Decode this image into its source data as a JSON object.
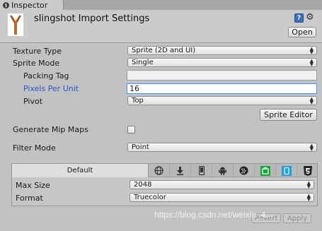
{
  "tab": {
    "title": "Inspector"
  },
  "header": {
    "asset_name": "slingshot Import Settings",
    "open_label": "Open"
  },
  "fields": {
    "texture_type": {
      "label": "Texture Type",
      "value": "Sprite (2D and UI)"
    },
    "sprite_mode": {
      "label": "Sprite Mode",
      "value": "Single"
    },
    "packing_tag": {
      "label": "Packing Tag",
      "value": ""
    },
    "pixels_per_unit": {
      "label": "Pixels Per Unit",
      "value": "16"
    },
    "pivot": {
      "label": "Pivot",
      "value": "Top"
    },
    "sprite_editor_label": "Sprite Editor",
    "generate_mip_maps": {
      "label": "Generate Mip Maps",
      "checked": false
    },
    "filter_mode": {
      "label": "Filter Mode",
      "value": "Point"
    }
  },
  "platform": {
    "default_tab": "Default",
    "tabs": [
      "web-icon",
      "download-icon",
      "phone-icon",
      "android-icon",
      "blackberry-icon",
      "windows-store-icon",
      "windows-phone-icon",
      "html5-icon"
    ],
    "max_size": {
      "label": "Max Size",
      "value": "2048"
    },
    "format": {
      "label": "Format",
      "value": "Truecolor"
    }
  },
  "footer": {
    "revert_label": "Revert",
    "apply_label": "Apply"
  },
  "watermark": "https://blog.csdn.net/weixin_4...",
  "colors": {
    "accent_blue": "#2c55c9",
    "focus_border": "#5b8ee0",
    "android_green": "#7cb342",
    "windows_green": "#17a53c",
    "winphone_blue": "#1ba1e2",
    "html5_black": "#222222"
  }
}
